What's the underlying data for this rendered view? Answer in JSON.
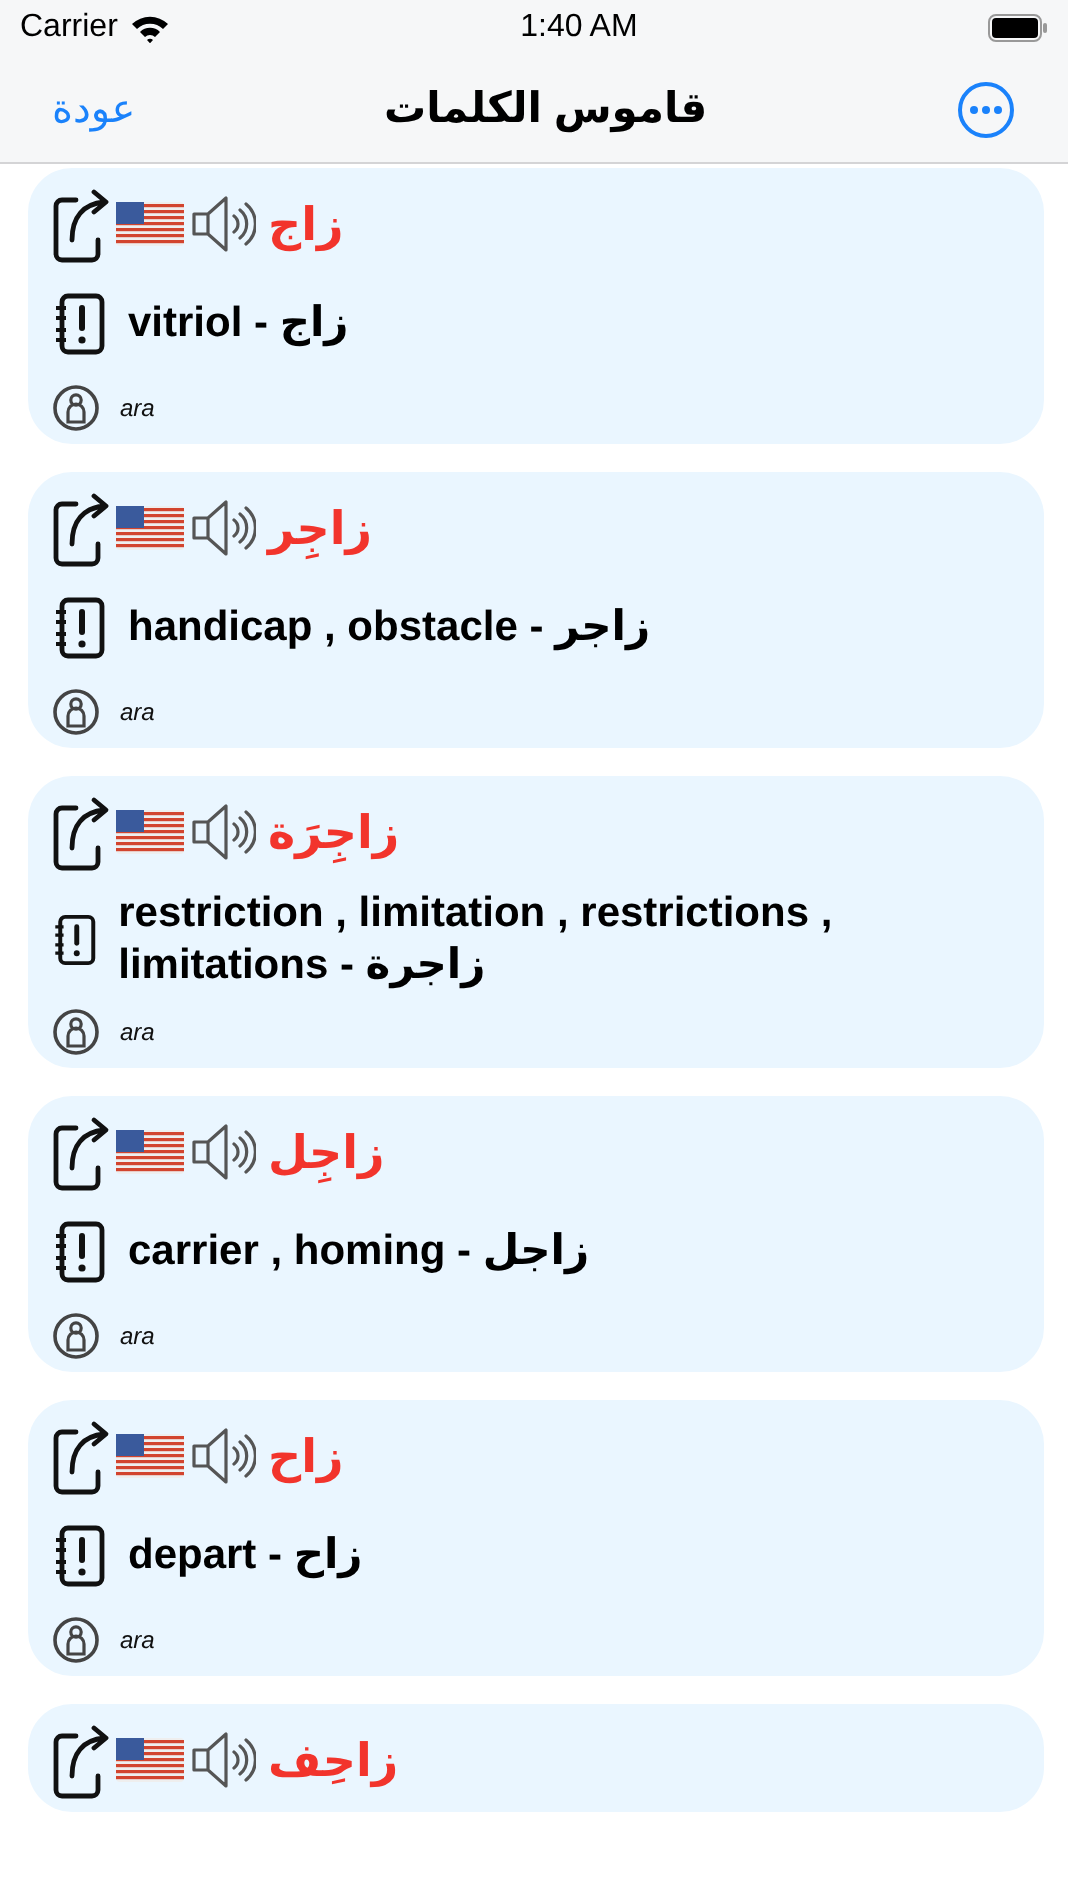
{
  "status_bar": {
    "carrier": "Carrier",
    "time": "1:40 AM"
  },
  "nav": {
    "back": "عودة",
    "title": "قاموس الكلمات"
  },
  "entries": [
    {
      "word": "زاج",
      "definition": "vitriol - زاج",
      "language": "ara"
    },
    {
      "word": "زاجِر",
      "definition": "handicap , obstacle - زاجر",
      "language": "ara"
    },
    {
      "word": "زاجِرَة",
      "definition": "restriction , limitation , restrictions , limitations - زاجرة",
      "language": "ara"
    },
    {
      "word": "زاجِل",
      "definition": "carrier , homing - زاجل",
      "language": "ara"
    },
    {
      "word": "زاح",
      "definition": "depart - زاح",
      "language": "ara"
    },
    {
      "word": "زاحِف"
    }
  ]
}
